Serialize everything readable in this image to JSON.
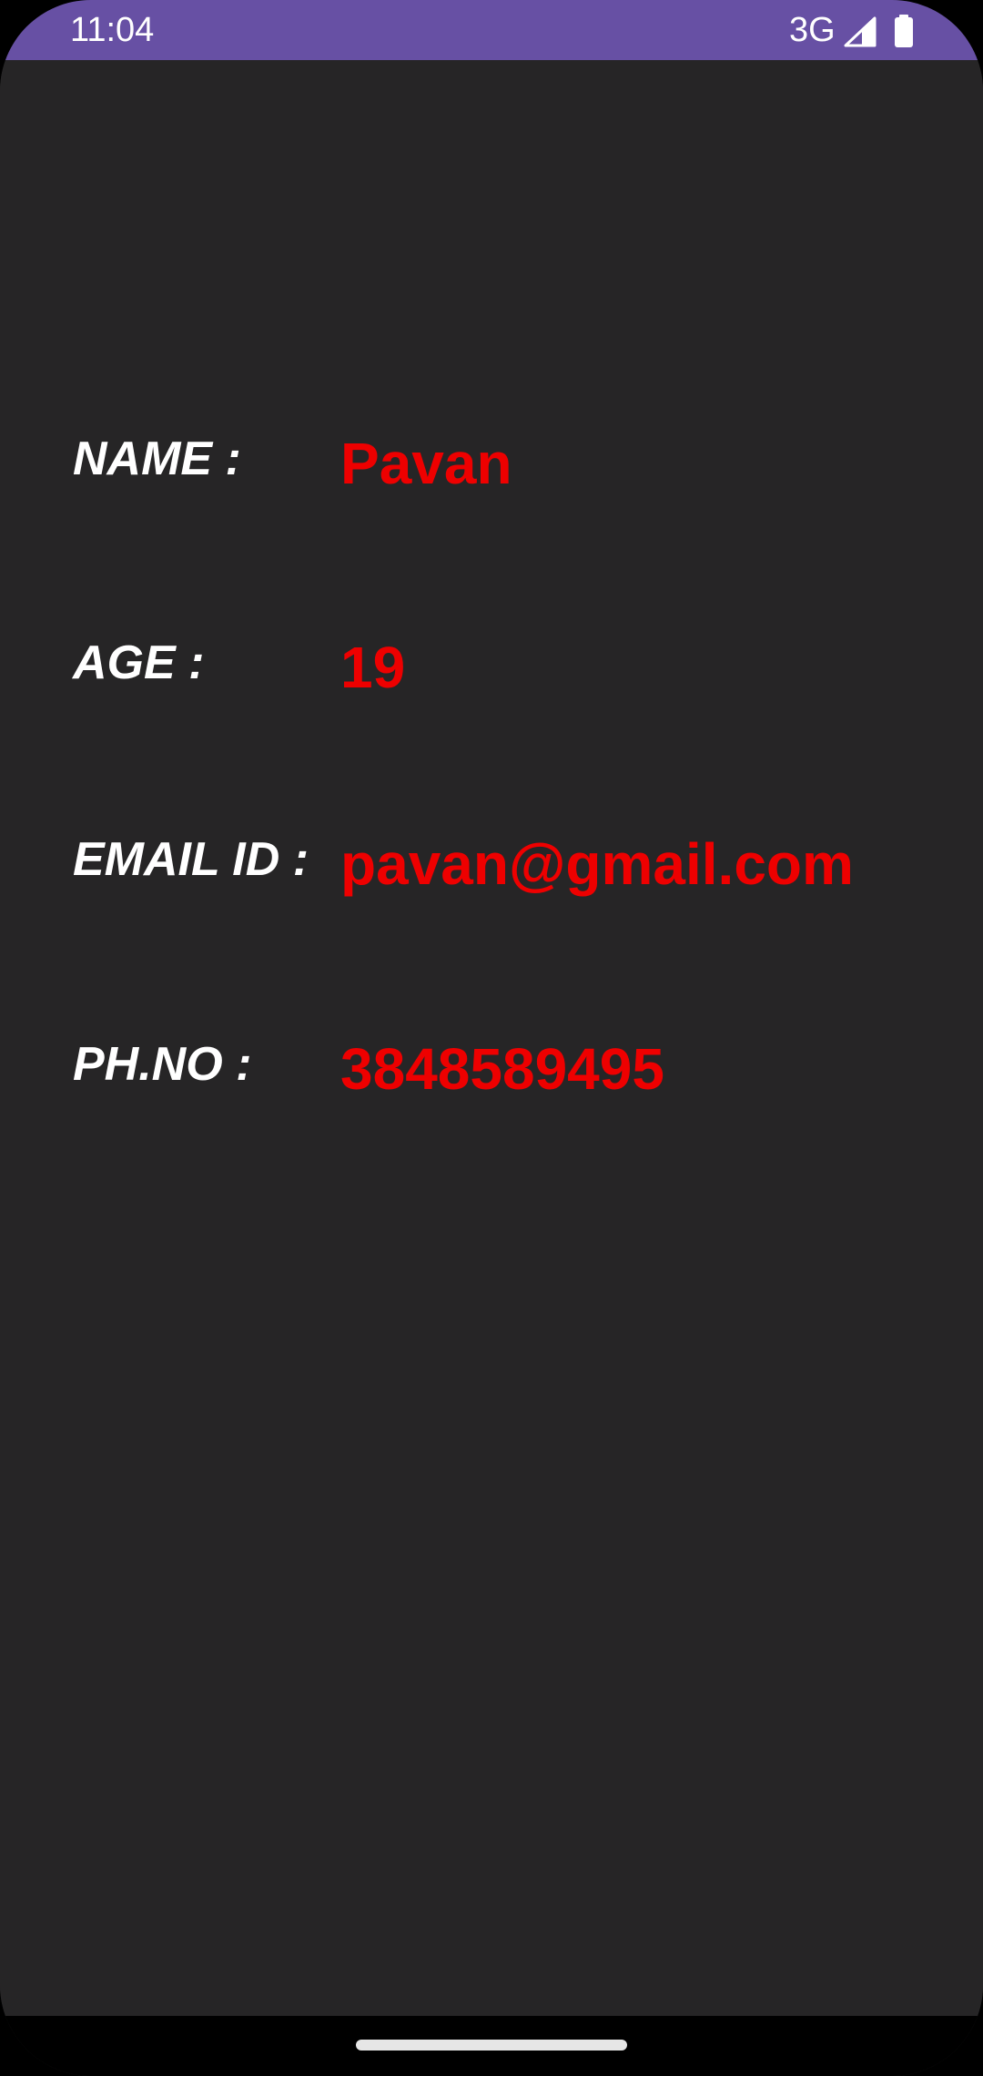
{
  "status_bar": {
    "time": "11:04",
    "network": "3G",
    "signal_icon": "cellular-signal-icon",
    "battery_icon": "battery-full-icon",
    "background_color": "#6750a4"
  },
  "profile": {
    "name": {
      "label": "NAME :",
      "value": "Pavan"
    },
    "age": {
      "label": "AGE :",
      "value": "19"
    },
    "email": {
      "label": "EMAIL ID :",
      "value": "pavan@gmail.com"
    },
    "phone": {
      "label": "PH.NO :",
      "value": "3848589495"
    }
  },
  "colors": {
    "background": "#262526",
    "label_text": "#ffffff",
    "value_text": "#ee0000"
  }
}
